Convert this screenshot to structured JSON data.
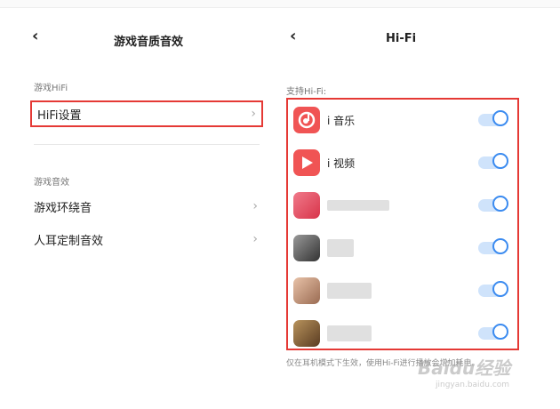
{
  "left": {
    "title": "游戏音质音效",
    "back": "‹",
    "section_hifi": "游戏HiFi",
    "hifi_setting": "HiFi设置",
    "section_effects": "游戏音效",
    "items": [
      {
        "label": "游戏环绕音"
      },
      {
        "label": "人耳定制音效"
      }
    ],
    "chevron": "›"
  },
  "right": {
    "title": "Hi-Fi",
    "back": "‹",
    "support_label": "支持Hi-Fi:",
    "apps": [
      {
        "name": "i 音乐",
        "enabled": true,
        "icon": "music-note-icon",
        "color": "#f05454"
      },
      {
        "name": "i 视频",
        "enabled": true,
        "icon": "play-icon",
        "color": "#f05454"
      },
      {
        "name": "",
        "enabled": true,
        "icon": "blurred-app-icon",
        "color": "#e04b5c"
      },
      {
        "name": "",
        "enabled": true,
        "icon": "blurred-app-icon",
        "color": "#555555"
      },
      {
        "name": "",
        "enabled": true,
        "icon": "blurred-app-icon",
        "color": "#c49a82"
      },
      {
        "name": "",
        "enabled": true,
        "icon": "blurred-app-icon",
        "color": "#8a6a40"
      }
    ],
    "footer": "仅在耳机模式下生效，使用Hi-Fi进行播放会增加耗电。"
  },
  "watermark": {
    "brand": "Baidu经验",
    "url": "jingyan.baidu.com"
  },
  "colors": {
    "highlight": "#e53935",
    "toggle": "#3b8bf0",
    "accent_icon": "#f05454"
  }
}
